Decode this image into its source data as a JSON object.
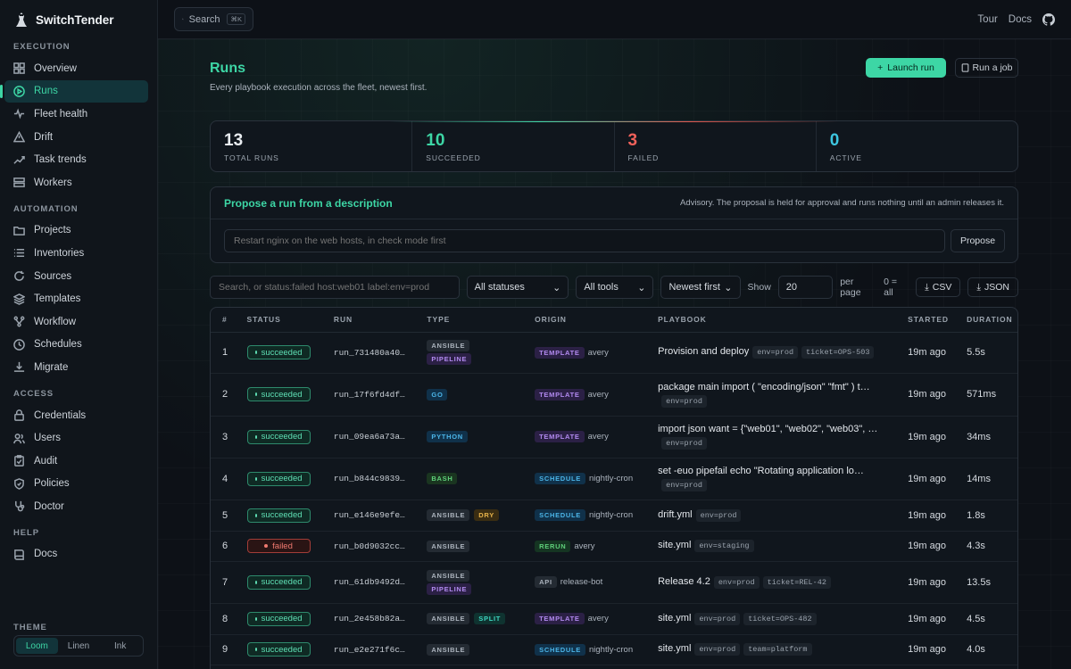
{
  "brand": {
    "name": "SwitchTender"
  },
  "sidebar": {
    "sections": [
      {
        "title": "EXECUTION",
        "items": [
          {
            "label": "Overview",
            "icon": "grid-icon"
          },
          {
            "label": "Runs",
            "icon": "play-circle-icon",
            "active": true
          },
          {
            "label": "Fleet health",
            "icon": "pulse-icon"
          },
          {
            "label": "Drift",
            "icon": "warning-icon"
          },
          {
            "label": "Task trends",
            "icon": "trend-icon"
          },
          {
            "label": "Workers",
            "icon": "server-icon"
          }
        ]
      },
      {
        "title": "AUTOMATION",
        "items": [
          {
            "label": "Projects",
            "icon": "folder-icon"
          },
          {
            "label": "Inventories",
            "icon": "list-icon"
          },
          {
            "label": "Sources",
            "icon": "refresh-icon"
          },
          {
            "label": "Templates",
            "icon": "layers-icon"
          },
          {
            "label": "Workflow",
            "icon": "workflow-icon"
          },
          {
            "label": "Schedules",
            "icon": "clock-icon"
          },
          {
            "label": "Migrate",
            "icon": "download-icon"
          }
        ]
      },
      {
        "title": "ACCESS",
        "items": [
          {
            "label": "Credentials",
            "icon": "lock-icon"
          },
          {
            "label": "Users",
            "icon": "users-icon"
          },
          {
            "label": "Audit",
            "icon": "clipboard-icon"
          },
          {
            "label": "Policies",
            "icon": "shield-icon"
          },
          {
            "label": "Doctor",
            "icon": "stethoscope-icon"
          }
        ]
      },
      {
        "title": "HELP",
        "items": [
          {
            "label": "Docs",
            "icon": "book-icon"
          }
        ]
      }
    ],
    "theme_label": "THEME",
    "themes": [
      "Loom",
      "Linen",
      "Ink"
    ],
    "active_theme": "Loom"
  },
  "topbar": {
    "search_label": "Search",
    "search_kbd": "⌘K",
    "tour": "Tour",
    "docs": "Docs"
  },
  "page": {
    "title": "Runs",
    "subtitle": "Every playbook execution across the fleet, newest first.",
    "launch_label": "Launch run",
    "runjob_label": "Run a job"
  },
  "stats": [
    {
      "value": "13",
      "label": "TOTAL RUNS",
      "color": "#e9edf1"
    },
    {
      "value": "10",
      "label": "SUCCEEDED",
      "color": "#3dd6a5"
    },
    {
      "value": "3",
      "label": "FAILED",
      "color": "#f0615a"
    },
    {
      "value": "0",
      "label": "ACTIVE",
      "color": "#3dc6e0"
    }
  ],
  "propose": {
    "title": "Propose a run from a description",
    "note": "Advisory. The proposal is held for approval and runs nothing until an admin releases it.",
    "placeholder": "Restart nginx on the web hosts, in check mode first",
    "button": "Propose"
  },
  "filters": {
    "search_placeholder": "Search, or status:failed host:web01 label:env=prod",
    "status": "All statuses",
    "tools": "All tools",
    "sort": "Newest first",
    "show_label": "Show",
    "per_page": "20",
    "per_page_label": "per page",
    "all_hint": "0 = all",
    "csv": "CSV",
    "json": "JSON"
  },
  "table": {
    "headers": [
      "#",
      "STATUS",
      "RUN",
      "TYPE",
      "ORIGIN",
      "PLAYBOOK",
      "STARTED",
      "DURATION"
    ],
    "rows": [
      {
        "n": "1",
        "status": "succeeded",
        "run": "run_731480a40…",
        "types": [
          "ANSIBLE",
          "PIPELINE"
        ],
        "origin": "TEMPLATE",
        "who": "avery",
        "playbook": "Provision and deploy",
        "labels": [
          "env=prod",
          "ticket=OPS-503"
        ],
        "started": "19m ago",
        "duration": "5.5s"
      },
      {
        "n": "2",
        "status": "succeeded",
        "run": "run_17f6fd4df…",
        "types": [
          "GO"
        ],
        "origin": "TEMPLATE",
        "who": "avery",
        "playbook": "package main import ( \"encoding/json\" \"fmt\" ) t…",
        "labels": [
          "env=prod"
        ],
        "started": "19m ago",
        "duration": "571ms"
      },
      {
        "n": "3",
        "status": "succeeded",
        "run": "run_09ea6a73a…",
        "types": [
          "PYTHON"
        ],
        "origin": "TEMPLATE",
        "who": "avery",
        "playbook": "import json want = {\"web01\", \"web02\", \"web03\", …",
        "labels": [
          "env=prod"
        ],
        "started": "19m ago",
        "duration": "34ms"
      },
      {
        "n": "4",
        "status": "succeeded",
        "run": "run_b844c9839…",
        "types": [
          "BASH"
        ],
        "origin": "SCHEDULE",
        "who": "nightly-cron",
        "playbook": "set -euo pipefail echo \"Rotating application lo…",
        "labels": [
          "env=prod"
        ],
        "started": "19m ago",
        "duration": "14ms"
      },
      {
        "n": "5",
        "status": "succeeded",
        "run": "run_e146e9efe…",
        "types": [
          "ANSIBLE",
          "DRY"
        ],
        "origin": "SCHEDULE",
        "who": "nightly-cron",
        "playbook": "drift.yml",
        "labels": [
          "env=prod"
        ],
        "started": "19m ago",
        "duration": "1.8s"
      },
      {
        "n": "6",
        "status": "failed",
        "run": "run_b0d9032cc…",
        "types": [
          "ANSIBLE"
        ],
        "origin": "RERUN",
        "who": "avery",
        "playbook": "site.yml",
        "labels": [
          "env=staging"
        ],
        "started": "19m ago",
        "duration": "4.3s"
      },
      {
        "n": "7",
        "status": "succeeded",
        "run": "run_61db9492d…",
        "types": [
          "ANSIBLE",
          "PIPELINE"
        ],
        "origin": "API",
        "who": "release-bot",
        "playbook": "Release 4.2",
        "labels": [
          "env=prod",
          "ticket=REL-42"
        ],
        "started": "19m ago",
        "duration": "13.5s"
      },
      {
        "n": "8",
        "status": "succeeded",
        "run": "run_2e458b82a…",
        "types": [
          "ANSIBLE",
          "SPLIT"
        ],
        "origin": "TEMPLATE",
        "who": "avery",
        "playbook": "site.yml",
        "labels": [
          "env=prod",
          "ticket=OPS-482"
        ],
        "started": "19m ago",
        "duration": "4.5s"
      },
      {
        "n": "9",
        "status": "succeeded",
        "run": "run_e2e271f6c…",
        "types": [
          "ANSIBLE"
        ],
        "origin": "SCHEDULE",
        "who": "nightly-cron",
        "playbook": "site.yml",
        "labels": [
          "env=prod",
          "team=platform"
        ],
        "started": "19m ago",
        "duration": "4.0s"
      }
    ]
  }
}
